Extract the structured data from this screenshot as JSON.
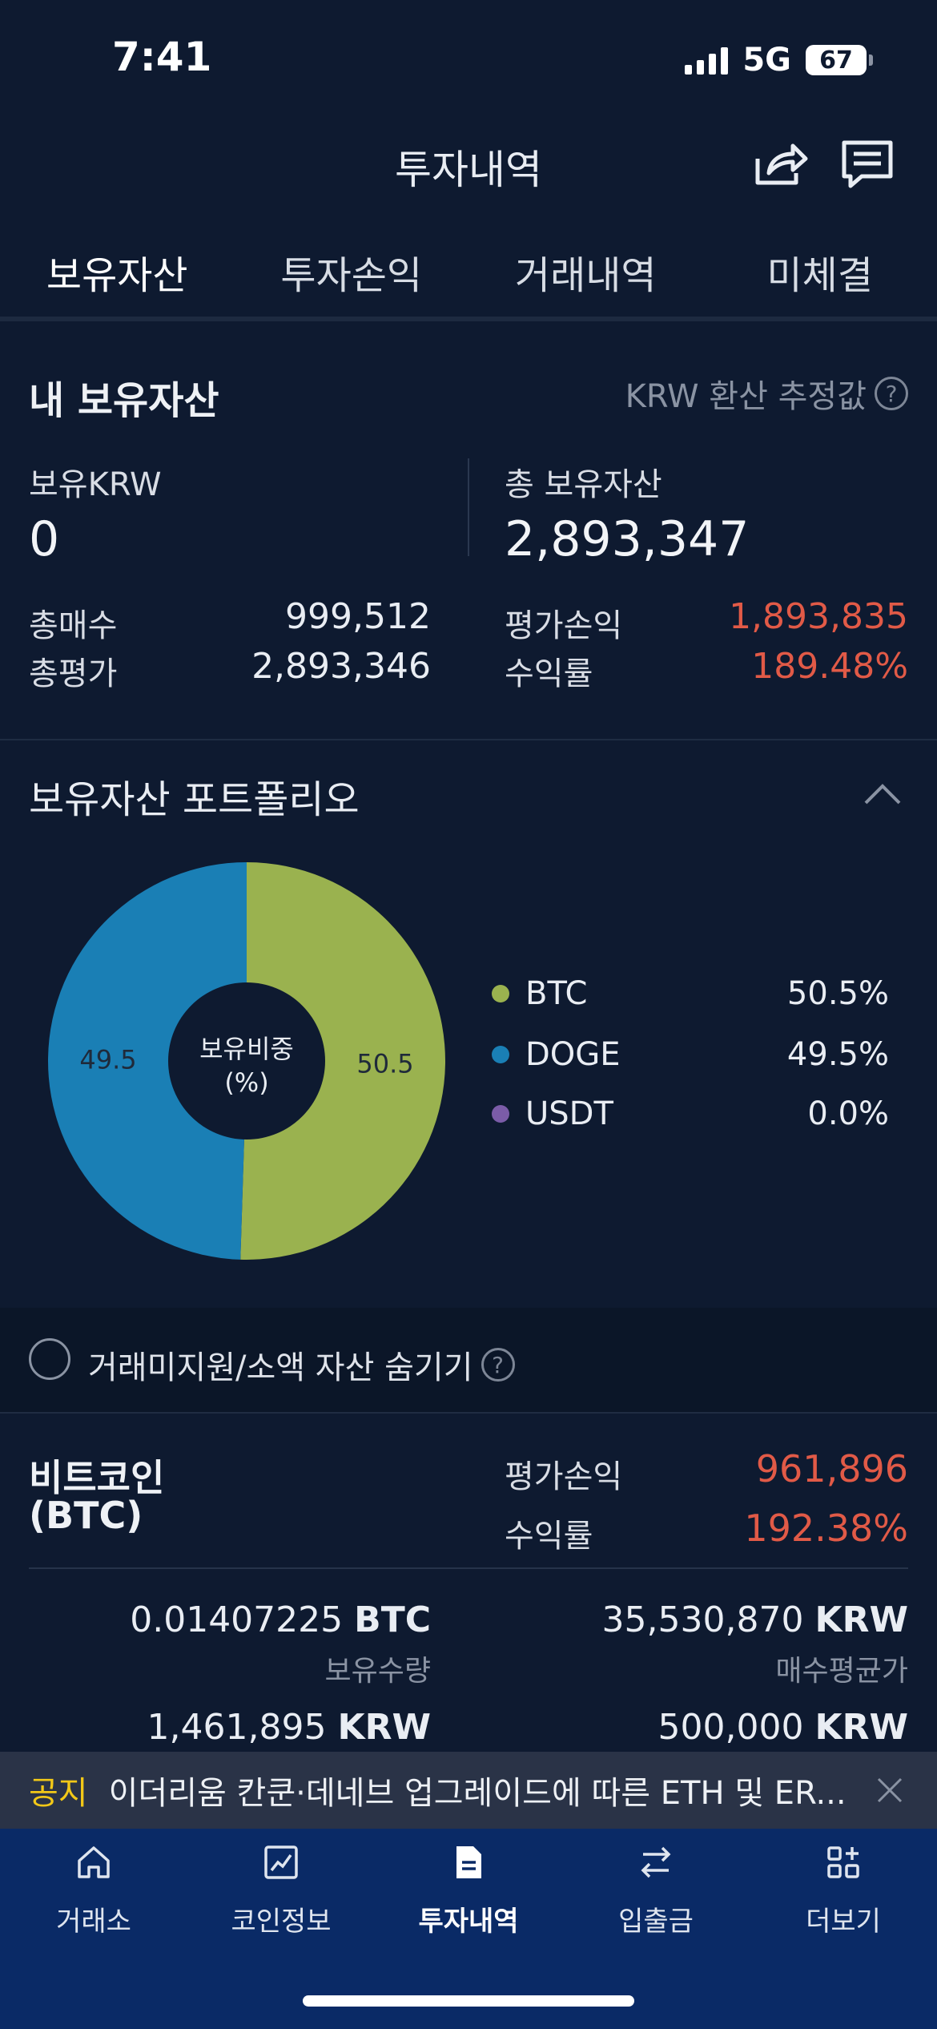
{
  "status": {
    "time": "7:41",
    "network": "5G",
    "battery": "67"
  },
  "header": {
    "title": "투자내역"
  },
  "tabs": [
    "보유자산",
    "투자손익",
    "거래내역",
    "미체결"
  ],
  "assets": {
    "title": "내 보유자산",
    "krw_note": "KRW 환산 추정값",
    "help": "?",
    "krw_label": "보유KRW",
    "krw_value": "0",
    "total_label": "총 보유자산",
    "total_value": "2,893,347",
    "buy_label": "총매수",
    "buy_value": "999,512",
    "eval_label": "총평가",
    "eval_value": "2,893,346",
    "pnl_label": "평가손익",
    "pnl_value": "1,893,835",
    "rate_label": "수익률",
    "rate_value": "189.48%"
  },
  "portfolio": {
    "title": "보유자산 포트폴리오",
    "center_line1": "보유비중",
    "center_line2": "(%)",
    "legend": [
      {
        "name": "BTC",
        "value": "50.5%",
        "color": "#9ab24f"
      },
      {
        "name": "DOGE",
        "value": "49.5%",
        "color": "#1a7fb5"
      },
      {
        "name": "USDT",
        "value": "0.0%",
        "color": "#7b5ca8"
      }
    ]
  },
  "chart_data": {
    "type": "pie",
    "donut": true,
    "categories": [
      "BTC",
      "DOGE",
      "USDT"
    ],
    "values": [
      50.5,
      49.5,
      0.0
    ],
    "slice_labels": [
      "50.5",
      "49.5"
    ],
    "colors": [
      "#9ab24f",
      "#1a7fb5",
      "#7b5ca8"
    ]
  },
  "hide_small": {
    "label": "거래미지원/소액 자산 숨기기"
  },
  "btc": {
    "name_line1": "비트코인",
    "name_line2": "(BTC)",
    "pnl_label": "평가손익",
    "pnl_value": "961,896",
    "rate_label": "수익률",
    "rate_value": "192.38%",
    "qty_value": "0.01407225",
    "qty_unit": "BTC",
    "qty_label": "보유수량",
    "avg_value": "35,530,870",
    "avg_unit": "KRW",
    "avg_label": "매수평균가",
    "row3_left_value": "1,461,895",
    "row3_left_unit": "KRW",
    "row3_right_value": "500,000",
    "row3_right_unit": "KRW"
  },
  "notice": {
    "tag": "공지",
    "text": "이더리움 칸쿤·데네브 업그레이드에 따른 ETH 및 ER..."
  },
  "nav": [
    {
      "label": "거래소",
      "icon": "home-icon"
    },
    {
      "label": "코인정보",
      "icon": "chart-icon"
    },
    {
      "label": "투자내역",
      "icon": "document-icon"
    },
    {
      "label": "입출금",
      "icon": "transfer-icon"
    },
    {
      "label": "더보기",
      "icon": "more-icon"
    }
  ]
}
